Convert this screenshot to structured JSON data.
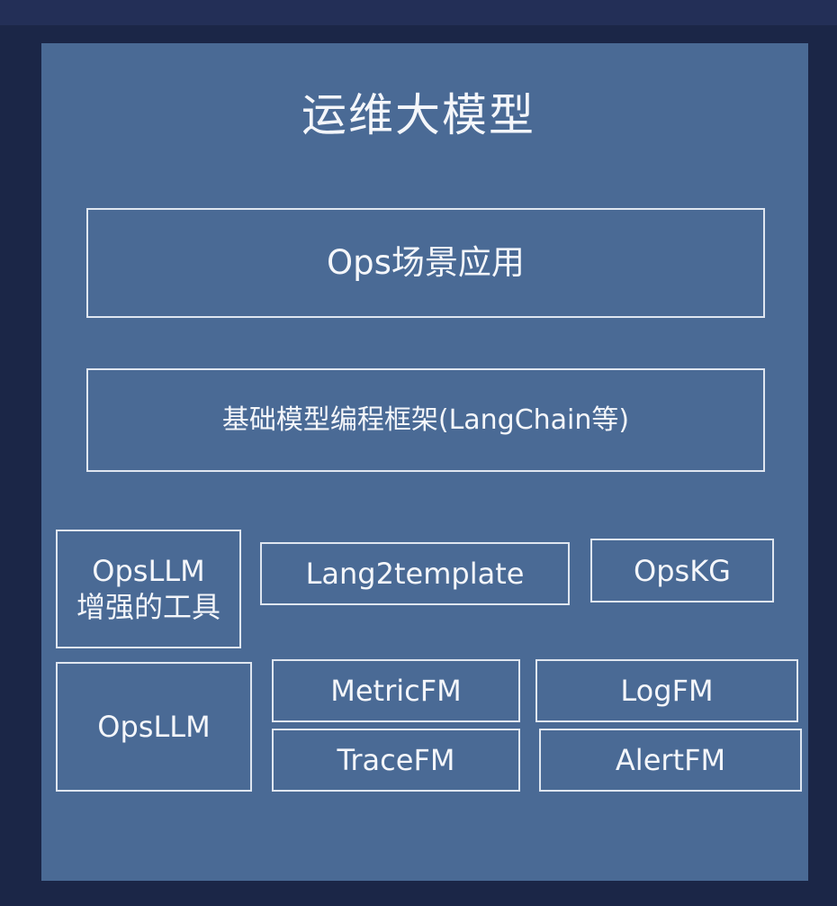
{
  "diagram": {
    "title": "运维大模型",
    "layers": {
      "application": "Ops场景应用",
      "framework": "基础模型编程框架(LangChain等)"
    },
    "tools": {
      "enhance_line1": "OpsLLM",
      "enhance_line2": "增强的工具",
      "lang2template": "Lang2template",
      "opskg": "OpsKG"
    },
    "models": {
      "opsllm": "OpsLLM",
      "metricfm": "MetricFM",
      "logfm": "LogFM",
      "tracefm": "TraceFM",
      "alertfm": "AlertFM"
    }
  },
  "colors": {
    "background": "#1b2647",
    "panel": "#4a6a95",
    "border": "#dfe6f0",
    "text": "#f4f6fa"
  }
}
